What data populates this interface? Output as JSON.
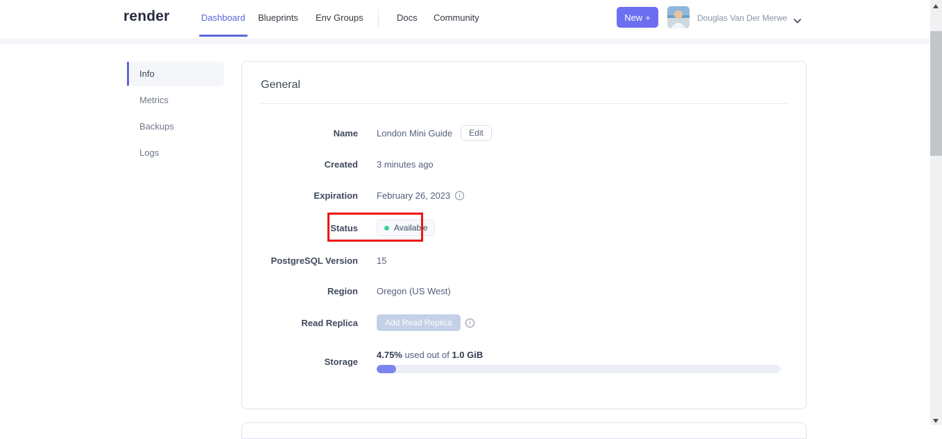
{
  "header": {
    "logo": "render",
    "nav": [
      {
        "label": "Dashboard",
        "active": true
      },
      {
        "label": "Blueprints",
        "active": false
      },
      {
        "label": "Env Groups",
        "active": false
      },
      {
        "label": "Docs",
        "active": false
      },
      {
        "label": "Community",
        "active": false
      }
    ],
    "new_button": {
      "label": "New",
      "plus": "+"
    },
    "user": {
      "name": "Douglas Van Der Merwe"
    }
  },
  "sidebar": {
    "items": [
      {
        "label": "Info",
        "active": true
      },
      {
        "label": "Metrics",
        "active": false
      },
      {
        "label": "Backups",
        "active": false
      },
      {
        "label": "Logs",
        "active": false
      }
    ]
  },
  "card": {
    "title": "General",
    "rows": {
      "name": {
        "label": "Name",
        "value": "London Mini Guide",
        "edit_label": "Edit"
      },
      "created": {
        "label": "Created",
        "value": "3 minutes ago"
      },
      "expiration": {
        "label": "Expiration",
        "value": "February 26, 2023"
      },
      "status": {
        "label": "Status",
        "value": "Available"
      },
      "postgresql_version": {
        "label": "PostgreSQL Version",
        "value": "15"
      },
      "region": {
        "label": "Region",
        "value": "Oregon (US West)"
      },
      "read_replica": {
        "label": "Read Replica",
        "button_label": "Add Read Replica"
      },
      "storage": {
        "label": "Storage",
        "used_percent": "4.75%",
        "middle_text": "used out of",
        "total": "1.0 GiB",
        "percent": 4.75
      }
    }
  },
  "colors": {
    "accent": "#5a67d8",
    "status_dot": "#38d39f",
    "annotation_red": "#ec1414",
    "progress_fill": "#7b85f0",
    "new_button": "#6a71f2"
  }
}
